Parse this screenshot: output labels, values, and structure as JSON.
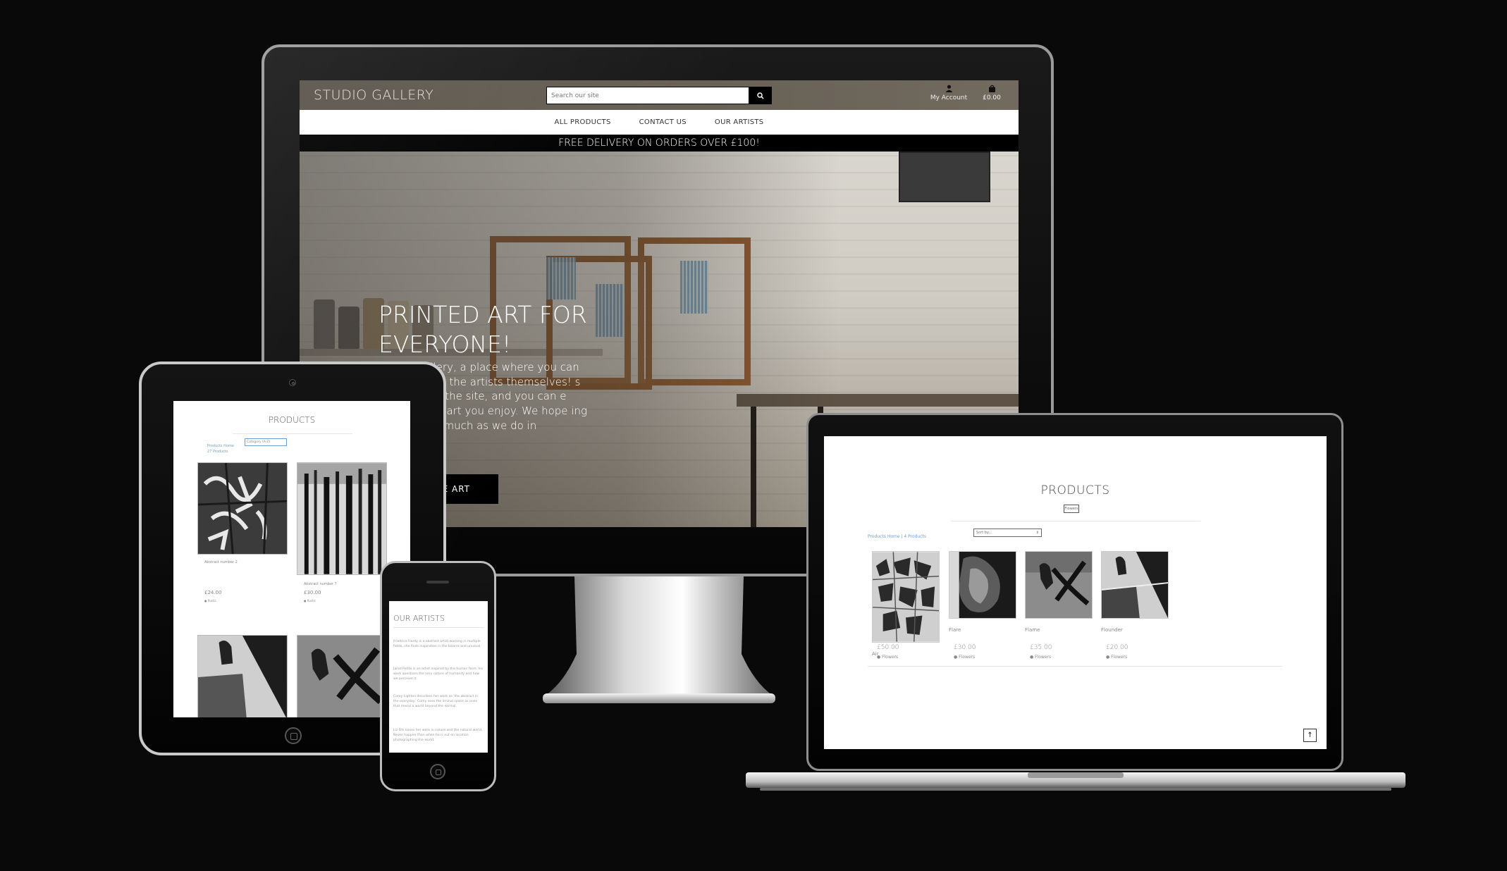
{
  "monitor": {
    "logo": "STUDIO GALLERY",
    "search_placeholder": "Search our site",
    "account_label": "My Account",
    "bag_total": "£0.00",
    "nav": [
      "ALL PRODUCTS",
      "CONTACT US",
      "OUR ARTISTS"
    ],
    "delivery_banner": "FREE DELIVERY ON ORDERS OVER £100!",
    "hero_title": "PRINTED ART FOR EVERYONE!",
    "hero_text": "Studio Gallery, a place where you can directly from the artists themselves! s exclusive to the site, and you can e prints of the art you enjoy. We hope ing our work as much as we do in",
    "hero_button": "E ART"
  },
  "laptop": {
    "title": "PRODUCTS",
    "category_chip": "Flowers",
    "sort_label": "Sort by...",
    "count_text": "Products Home | 4 Products",
    "products": [
      {
        "name": "Air",
        "price": "£50.00",
        "tag": "Flowers"
      },
      {
        "name": "Flare",
        "price": "£30.00",
        "tag": "Flowers"
      },
      {
        "name": "Flame",
        "price": "£35.00",
        "tag": "Flowers"
      },
      {
        "name": "Flounder",
        "price": "£20.00",
        "tag": "Flowers"
      }
    ],
    "back_to_top": "↑"
  },
  "tablet": {
    "title": "PRODUCTS",
    "select_label": "Category (A-Z)",
    "count_line1": "Products Home",
    "count_line2": "27 Products",
    "products": [
      {
        "name": "Abstract number 2",
        "price": "£24.00",
        "tag": "Rustic"
      },
      {
        "name": "Abstract number 7",
        "price": "£30.00",
        "tag": "Rustic"
      }
    ]
  },
  "phone": {
    "title": "OUR ARTISTS",
    "paragraphs": [
      "Friedrica Hardy is a abstract artist working in multiple fields, she finds inspiration in the bizarre and unusual.",
      "Jared Petite is an artist inspired by the human form, his work questions the very nature of humanity and how we perceive it.",
      "Corey Lighton describes her work as 'the abstract in the everyday.' Corey sees the liminal space as ones that reveal a world beyond the normal.",
      "Liz Ohl bases her work in nature and the natural world. Never happier than when he is out on location photographing the world."
    ]
  },
  "colors": {
    "background": "#0a0909",
    "link_blue": "#6b9fd6",
    "delivery_bg": "#000000"
  },
  "icons": [
    "search-icon",
    "user-icon",
    "shopping-bag-icon",
    "tag-icon",
    "arrow-up-icon"
  ]
}
